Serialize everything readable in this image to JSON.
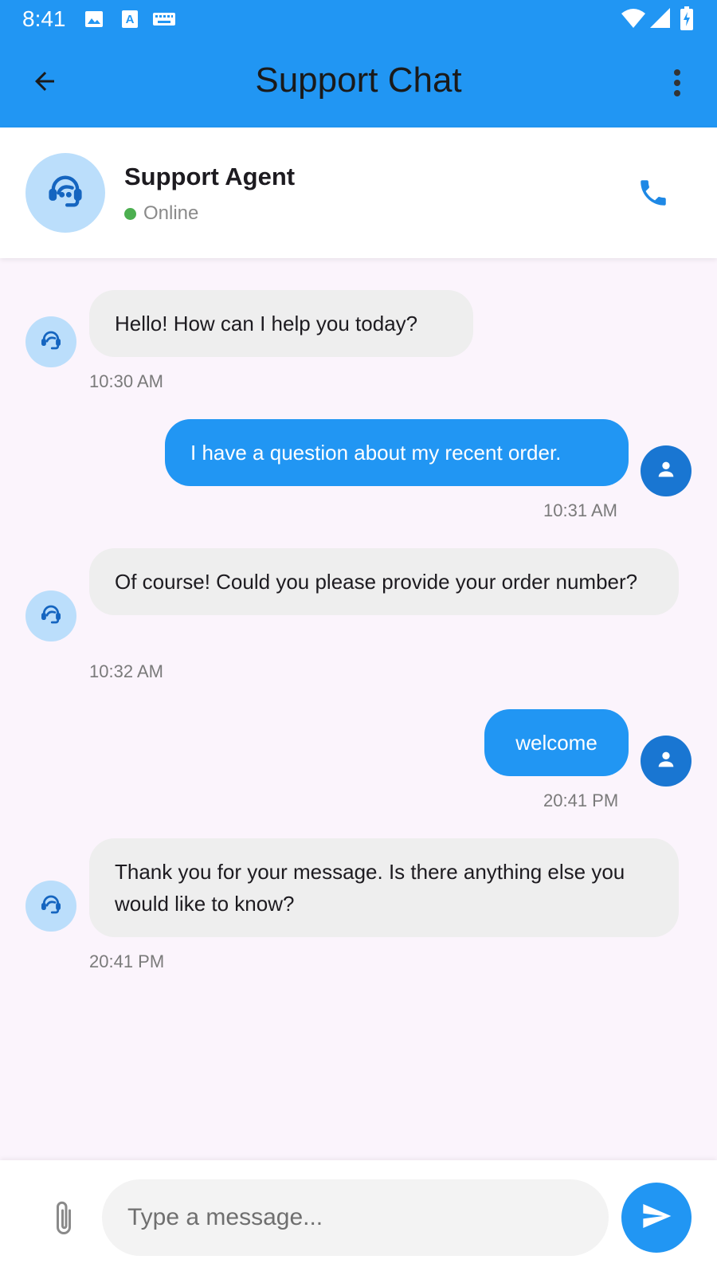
{
  "status_bar": {
    "time": "8:41",
    "icons": [
      "image-icon",
      "text-a-icon",
      "keyboard-icon",
      "wifi-icon",
      "signal-icon",
      "battery-charging-icon"
    ]
  },
  "app_bar": {
    "title": "Support Chat",
    "back_icon": "arrow-back-icon",
    "menu_icon": "more-vert-icon"
  },
  "agent": {
    "name": "Support Agent",
    "status": "Online",
    "avatar_icon": "support-agent-icon",
    "call_icon": "phone-icon"
  },
  "messages": [
    {
      "sender": "agent",
      "text": "Hello! How can I help you today?",
      "time": "10:30 AM"
    },
    {
      "sender": "user",
      "text": "I have a question about my recent order.",
      "time": "10:31 AM"
    },
    {
      "sender": "agent",
      "text": "Of course! Could you please provide your order number?",
      "time": "10:32 AM"
    },
    {
      "sender": "user",
      "text": "welcome",
      "time": "20:41 PM"
    },
    {
      "sender": "agent",
      "text": "Thank you for your message. Is there anything else you would like to know?",
      "time": "20:41 PM"
    }
  ],
  "composer": {
    "placeholder": "Type a message...",
    "value": "",
    "attach_icon": "attach-file-icon",
    "send_icon": "send-icon"
  },
  "colors": {
    "primary": "#2196f3",
    "user_avatar": "#1976d2",
    "agent_avatar_bg": "#bbdefb",
    "agent_bubble": "#eeeeee",
    "chat_background": "#fbf4fc",
    "online": "#4caf50"
  }
}
